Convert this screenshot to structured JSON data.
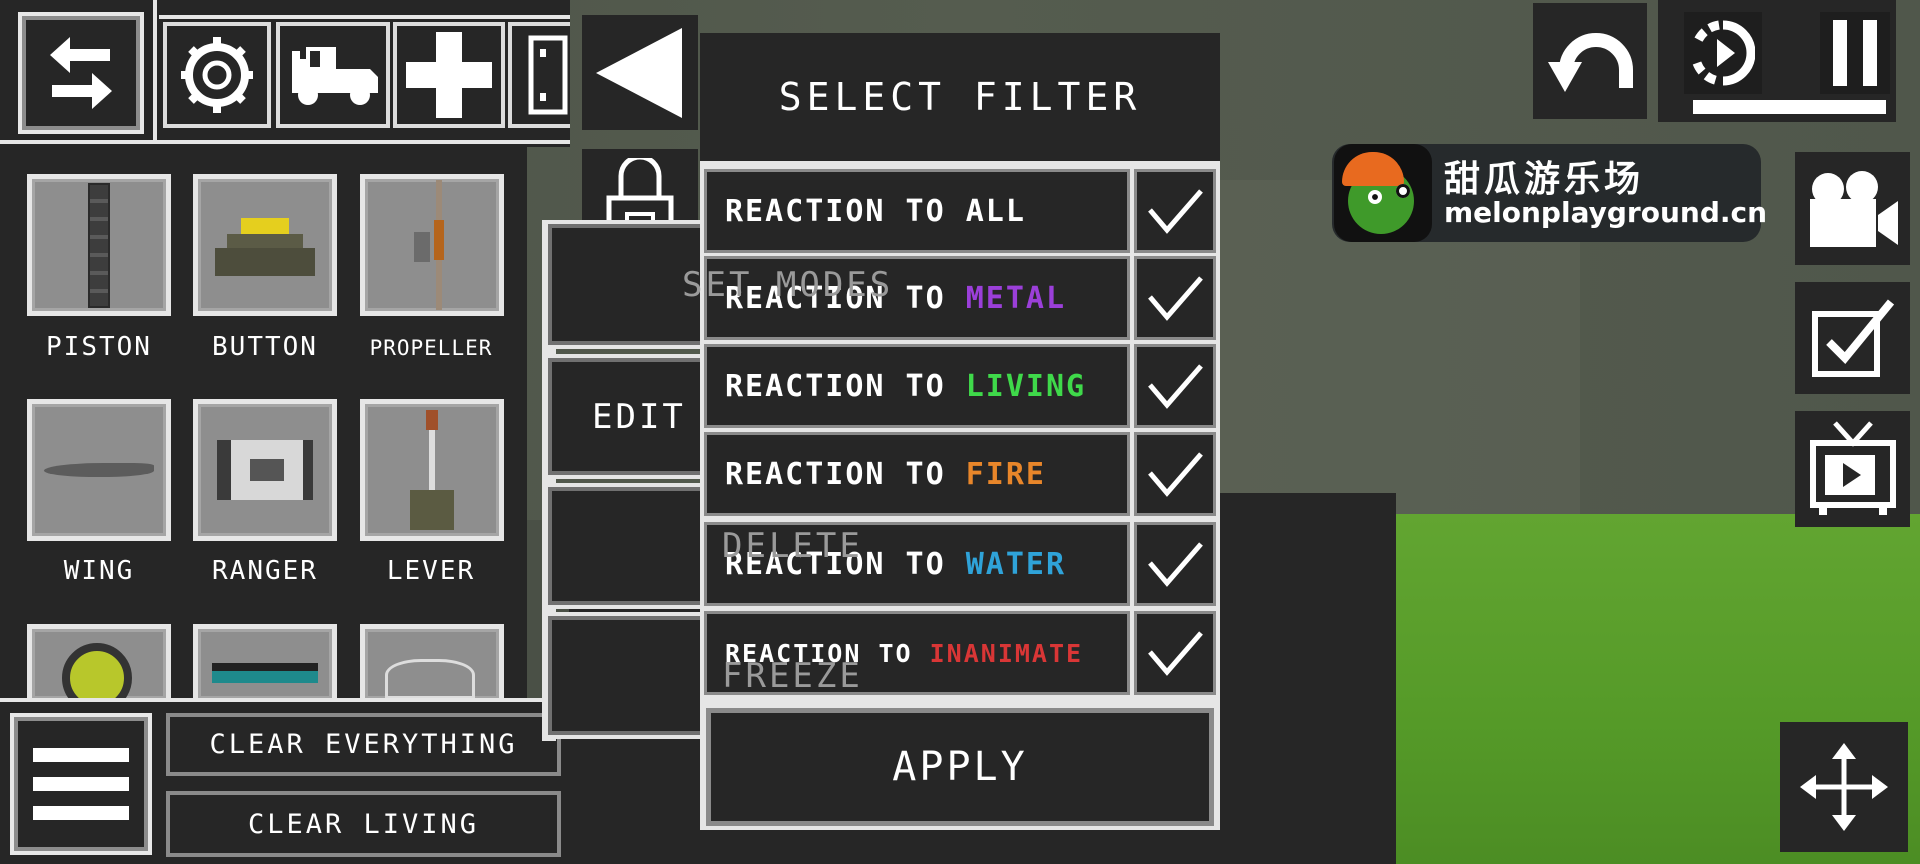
{
  "toolbar": {
    "swap": "swap-arrows-icon",
    "categories": [
      {
        "icon": "gear-icon"
      },
      {
        "icon": "jeep-icon"
      },
      {
        "icon": "plus-icon"
      },
      {
        "icon": "machinery-icon"
      }
    ]
  },
  "items": [
    {
      "label": "PISTON"
    },
    {
      "label": "BUTTON"
    },
    {
      "label": "PROPELLER"
    },
    {
      "label": "WING"
    },
    {
      "label": "RANGER"
    },
    {
      "label": "LEVER"
    },
    {
      "label": ""
    },
    {
      "label": ""
    },
    {
      "label": ""
    }
  ],
  "bottom": {
    "clear_everything": "CLEAR EVERYTHING",
    "clear_living": "CLEAR LIVING"
  },
  "context_menu": {
    "items": [
      "SET MODES",
      "EDIT PARAMETERS",
      "DELETE",
      "FREEZE"
    ]
  },
  "filter": {
    "title": "SELECT FILTER",
    "rows": [
      {
        "prefix": "REACTION TO ",
        "keyword": "ALL",
        "color": "#ffffff",
        "checked": true
      },
      {
        "prefix": "REACTION TO ",
        "keyword": "METAL",
        "color": "#9b3fd9",
        "checked": true
      },
      {
        "prefix": "REACTION TO ",
        "keyword": "LIVING",
        "color": "#3fd94a",
        "checked": true
      },
      {
        "prefix": "REACTION TO ",
        "keyword": "FIRE",
        "color": "#e8862a",
        "checked": true
      },
      {
        "prefix": "REACTION TO ",
        "keyword": "WATER",
        "color": "#2fa3d9",
        "checked": true
      },
      {
        "prefix": "REACTION TO ",
        "keyword": "INANIMATE",
        "color": "#d93636",
        "checked": true
      }
    ],
    "apply": "APPLY"
  },
  "watermark": {
    "title": "甜瓜游乐场",
    "url": "melonplayground.cn"
  },
  "time_progress": 1.0
}
